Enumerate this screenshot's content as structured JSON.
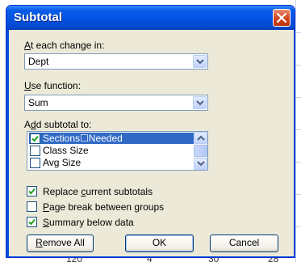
{
  "window": {
    "title": "Subtotal"
  },
  "at_each_change": {
    "label_prefix": "",
    "label_mnemonic": "A",
    "label_rest": "t each change in:",
    "value": "Dept"
  },
  "use_function": {
    "label_mnemonic": "U",
    "label_rest": "se function:",
    "value": "Sum"
  },
  "add_subtotal": {
    "label_prefix": "A",
    "label_mnemonic": "d",
    "label_rest": "d subtotal to:",
    "items": [
      {
        "label": "Sections☐Needed",
        "checked": true,
        "selected": true
      },
      {
        "label": "Class Size",
        "checked": false,
        "selected": false
      },
      {
        "label": "Avg Size",
        "checked": false,
        "selected": false
      }
    ]
  },
  "options": {
    "replace": {
      "prefix": "Replace ",
      "mnemonic": "c",
      "rest": "urrent subtotals",
      "checked": true
    },
    "page_break": {
      "prefix": "",
      "mnemonic": "P",
      "rest": "age break between groups",
      "checked": false
    },
    "summary": {
      "prefix": "",
      "mnemonic": "S",
      "rest": "ummary below data",
      "checked": true
    }
  },
  "buttons": {
    "remove_all_prefix": "",
    "remove_all_mnemonic": "R",
    "remove_all_rest": "emove All",
    "ok": "OK",
    "cancel": "Cancel"
  },
  "background_row": [
    "120",
    "4",
    "30",
    "28"
  ],
  "colors": {
    "titlebar": "#0554e3",
    "selection": "#316ac5",
    "dialog_bg": "#ece9d8"
  }
}
